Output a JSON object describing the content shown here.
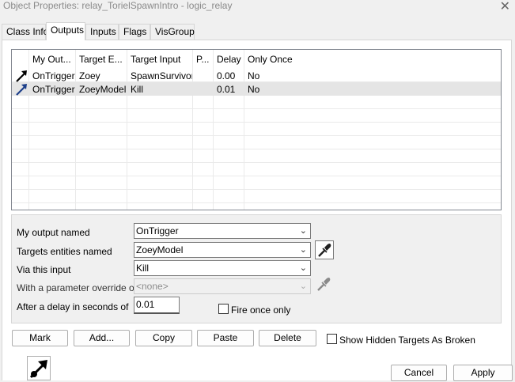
{
  "window": {
    "title": "Object Properties: relay_TorielSpawnIntro - logic_relay",
    "close_glyph": "✕"
  },
  "tabs": [
    {
      "label": "Class Info",
      "active": false
    },
    {
      "label": "Outputs",
      "active": true
    },
    {
      "label": "Inputs",
      "active": false
    },
    {
      "label": "Flags",
      "active": false
    },
    {
      "label": "VisGroup",
      "active": false
    }
  ],
  "outputs_grid": {
    "columns": [
      "My Out...",
      "Target E...",
      "Target Input",
      "P...",
      "Delay",
      "Only Once"
    ],
    "rows": [
      {
        "icon": "output-arrow-icon",
        "output": "OnTrigger",
        "target": "Zoey",
        "input": "SpawnSurvivor",
        "param": "",
        "delay": "0.00",
        "once": "No",
        "selected": false
      },
      {
        "icon": "output-arrow-icon",
        "output": "OnTrigger",
        "target": "ZoeyModel",
        "input": "Kill",
        "param": "",
        "delay": "0.01",
        "once": "No",
        "selected": true
      }
    ]
  },
  "editor": {
    "output_label": "My output named",
    "output_value": "OnTrigger",
    "target_label": "Targets entities named",
    "target_value": "ZoeyModel",
    "input_label": "Via this input",
    "input_value": "Kill",
    "param_label": "With a parameter override of",
    "param_value": "<none>",
    "delay_label": "After a delay in seconds of",
    "delay_value": "0.01",
    "fire_once_label": "Fire once only",
    "fire_once_checked": false,
    "eyedropper_icon": "eyedropper-icon",
    "chevron_glyph": "⌄"
  },
  "buttons": {
    "mark": "Mark",
    "add": "Add...",
    "copy": "Copy",
    "paste": "Paste",
    "delete": "Delete",
    "show_hidden_label": "Show Hidden Targets As Broken",
    "show_hidden_checked": false
  },
  "footer": {
    "cancel": "Cancel",
    "apply": "Apply",
    "entity_icon": "output-arrow-icon"
  }
}
